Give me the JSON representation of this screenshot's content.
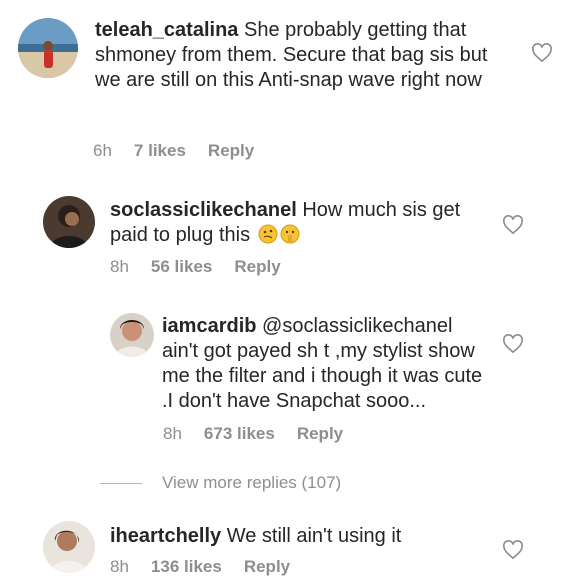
{
  "comments": [
    {
      "username": "teleah_catalina",
      "text": " She probably getting that shmoney from them. Secure that bag sis but we are still on this Anti-snap wave right now",
      "time": "6h",
      "likes": "7 likes",
      "reply": "Reply",
      "avatar_icon": "beach-photo"
    },
    {
      "username": "soclassiclikechanel",
      "text": " How much sis get paid to plug this",
      "emojis": [
        "woozy-face-emoji",
        "shushing-face-emoji"
      ],
      "time": "8h",
      "likes": "56 likes",
      "reply": "Reply",
      "avatar_icon": "person-photo"
    },
    {
      "username": "iamcardib",
      "mention": " @soclassiclikechanel",
      "text": "ain't got payed sh t ,my stylist show me the filter and i though it was cute .I don't have Snapchat sooo...",
      "time": "8h",
      "likes": "673 likes",
      "reply": "Reply",
      "avatar_icon": "person-photo"
    },
    {
      "username": "iheartchelly",
      "text": " We still ain't using it",
      "time": "8h",
      "likes": "136 likes",
      "reply": "Reply",
      "avatar_icon": "person-photo"
    }
  ],
  "view_more": "View more replies (107)",
  "colors": {
    "text": "#262626",
    "meta": "#8e8e8e"
  }
}
